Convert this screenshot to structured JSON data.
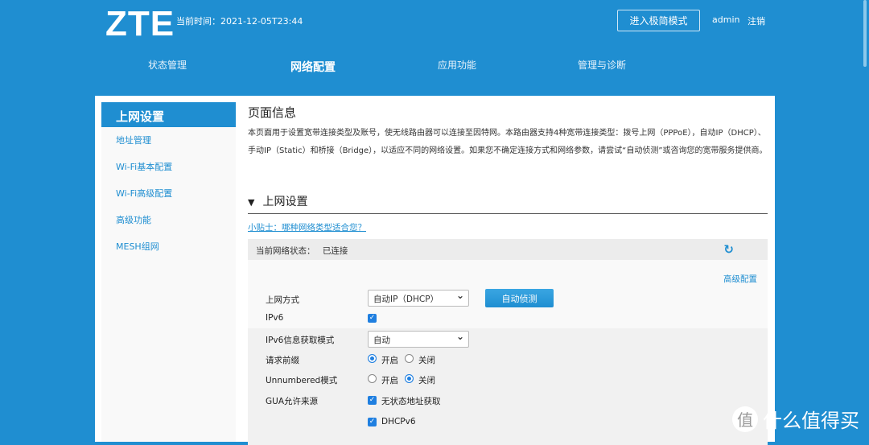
{
  "header": {
    "logo": "ZTE",
    "time": "当前时间：2021-12-05T23:44",
    "simple_mode": "进入极简模式",
    "user": "admin",
    "logout": "注销"
  },
  "nav": [
    "状态管理",
    "网络配置",
    "应用功能",
    "管理与诊断"
  ],
  "sidebar": {
    "title": "上网设置",
    "items": [
      "地址管理",
      "Wi-Fi基本配置",
      "Wi-Fi高级配置",
      "高级功能",
      "MESH组网"
    ]
  },
  "main": {
    "title": "页面信息",
    "description": "本页面用于设置宽带连接类型及账号，使无线路由器可以连接至因特网。本路由器支持4种宽带连接类型：拨号上网（PPPoE），自动IP（DHCP）、手动IP（Static）和桥接（Bridge），以适应不同的网络设置。如果您不确定连接方式和网络参数，请尝试“自动侦测”或咨询您的宽带服务提供商。",
    "section": "上网设置",
    "section_arrow": "▼",
    "tip": "小贴士：哪种网络类型适合您？",
    "status_label": "当前网络状态：",
    "status_value": "已连接",
    "refresh_icon": "↻",
    "advanced": "高级配置",
    "form": {
      "wan_label": "上网方式",
      "wan_value": "自动IP（DHCP）",
      "detect": "自动侦测",
      "ipv6_label": "IPv6",
      "ipv6_checked": true,
      "ipv6mode_label": "IPv6信息获取模式",
      "ipv6mode_value": "自动",
      "prefix_label": "请求前缀",
      "on": "开启",
      "off": "关闭",
      "prefix_value": "开启",
      "unnumbered_label": "Unnumbered模式",
      "unnumbered_value": "关闭",
      "gua_label": "GUA允许来源",
      "gua_opt1": "无状态地址获取",
      "gua_opt2": "DHCPv6"
    }
  },
  "watermark": {
    "circle": "值",
    "text": "什么值得买"
  }
}
